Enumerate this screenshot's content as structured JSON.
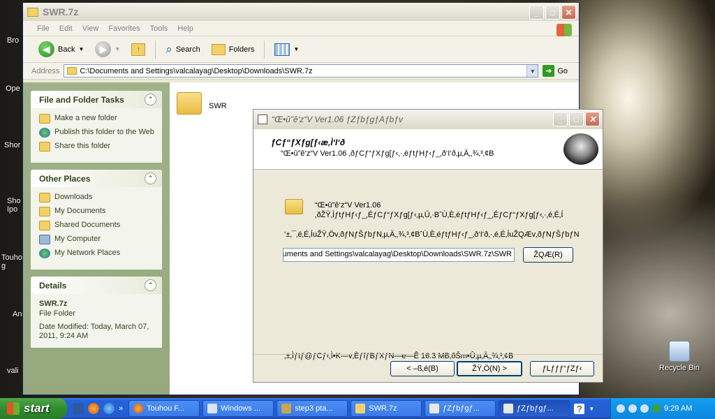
{
  "desktop": {
    "recycle_bin": "Recycle Bin",
    "left_fragments": [
      "Bro",
      "Ope",
      "Shor",
      "Sho Ipo",
      "Touho g",
      "An",
      "vali"
    ]
  },
  "explorer": {
    "title": "SWR.7z",
    "menu": [
      "File",
      "Edit",
      "View",
      "Favorites",
      "Tools",
      "Help"
    ],
    "toolbar": {
      "back": "Back",
      "search": "Search",
      "folders": "Folders"
    },
    "address_label": "Address",
    "address_value": "C:\\Documents and Settings\\valcalayag\\Desktop\\Downloads\\SWR.7z",
    "go": "Go",
    "tasks": {
      "title": "File and Folder Tasks",
      "items": [
        "Make a new folder",
        "Publish this folder to the Web",
        "Share this folder"
      ]
    },
    "places": {
      "title": "Other Places",
      "items": [
        "Downloads",
        "My Documents",
        "Shared Documents",
        "My Computer",
        "My Network Places"
      ]
    },
    "details": {
      "title": "Details",
      "name": "SWR.7z",
      "type": "File Folder",
      "modified": "Date Modified: Today, March 07, 2011, 9:24 AM"
    },
    "folder_item": "SWR"
  },
  "installer": {
    "title": "“Œ•û”ê‘z“V Ver1.06 ƒZƒbƒgƒAƒbƒv",
    "header_title": "ƒCƒ“ƒXƒg[ƒ‹æ‚Ì‘I‘ð",
    "header_sub": "“Œ•û”ê‘z“V Ver1.06 ‚ðƒCƒ“ƒXƒg[ƒ‹‚·‚éƒtƒHƒ‹ƒ_‚ð‘I‘ð‚µ‚Ä‚­‚¾‚³‚¢B",
    "line1": "“Œ•û”ê‘z“V Ver1.06",
    "line2": "‚ðŽŸ‚ÌƒtƒHƒ‹ƒ_‚ÉƒCƒ“ƒXƒg[ƒ‹‚µ‚Ü‚·BˆÙ‚È‚éƒtƒHƒ‹ƒ_‚ÉƒCƒ“ƒXƒg[ƒ‹‚·‚é‚É‚Í",
    "line3": "‘±‚¯‚é‚É‚ÍuŽŸ‚Öv‚ðƒNƒŠƒbƒN‚µ‚Ä‚­‚¾‚³‚¢BˆÙ‚È‚éƒtƒHƒ‹ƒ_‚ð‘I‘ð‚·‚é‚É‚ÍuŽQÆv‚ðƒNƒŠƒbƒN",
    "path": "C:\\Documents and Settings\\valcalayag\\Desktop\\Downloads\\SWR.7z\\SWR",
    "browse": "ŽQÆ(R)",
    "space_required": "‚±‚Ìƒtƒ@ƒCƒ‹‚Ì•K—v‚ÈƒfƒBƒXƒN—e—Ê 16.3 MB‚ðŠm•Û‚µ‚Ä‚­‚¾‚³‚¢B",
    "back": "< –ß‚é(B)",
    "next": "ŽŸ‚Ö(N) >",
    "cancel": "ƒLƒƒƒ“ƒZƒ‹"
  },
  "taskbar": {
    "start": "start",
    "tasks": [
      "Touhou F...",
      "Windows ...",
      "step3 pta...",
      "SWR.7z",
      "ƒZƒbƒgƒ...",
      "ƒZƒbƒgƒ..."
    ],
    "clock": "9:29 AM"
  }
}
